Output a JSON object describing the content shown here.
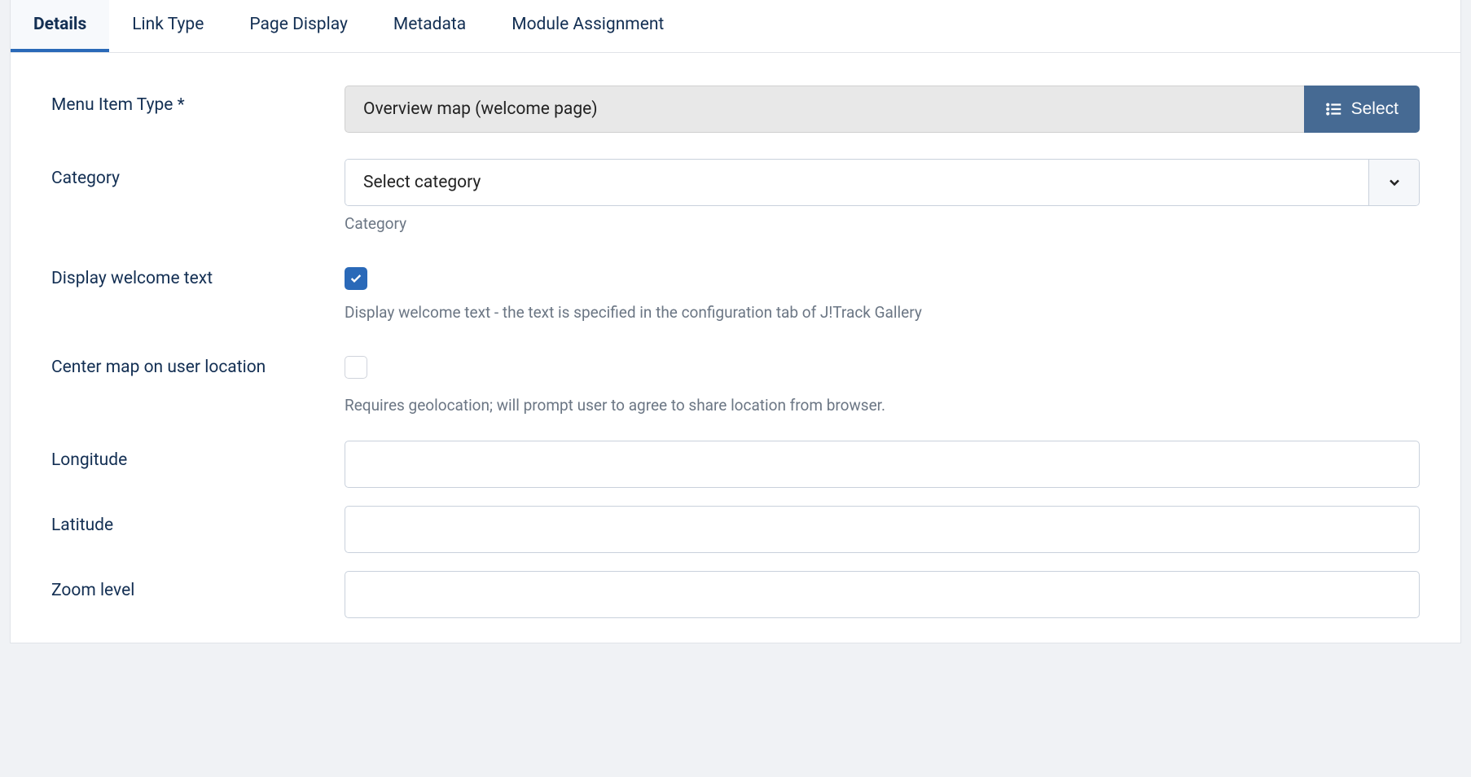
{
  "tabs": {
    "details": "Details",
    "link_type": "Link Type",
    "page_display": "Page Display",
    "metadata": "Metadata",
    "module_assignment": "Module Assignment"
  },
  "labels": {
    "menu_item_type": "Menu Item Type *",
    "category": "Category",
    "display_welcome_text": "Display welcome text",
    "center_map": "Center map on user location",
    "longitude": "Longitude",
    "latitude": "Latitude",
    "zoom_level": "Zoom level"
  },
  "values": {
    "menu_item_type": "Overview map (welcome page)",
    "category_selected": "Select category",
    "longitude": "",
    "latitude": "",
    "zoom_level": ""
  },
  "buttons": {
    "select": "Select"
  },
  "help": {
    "category": "Category",
    "display_welcome_text": "Display welcome text - the text is specified in the configuration tab of J!Track Gallery",
    "center_map": "Requires geolocation; will prompt user to agree to share location from browser."
  }
}
